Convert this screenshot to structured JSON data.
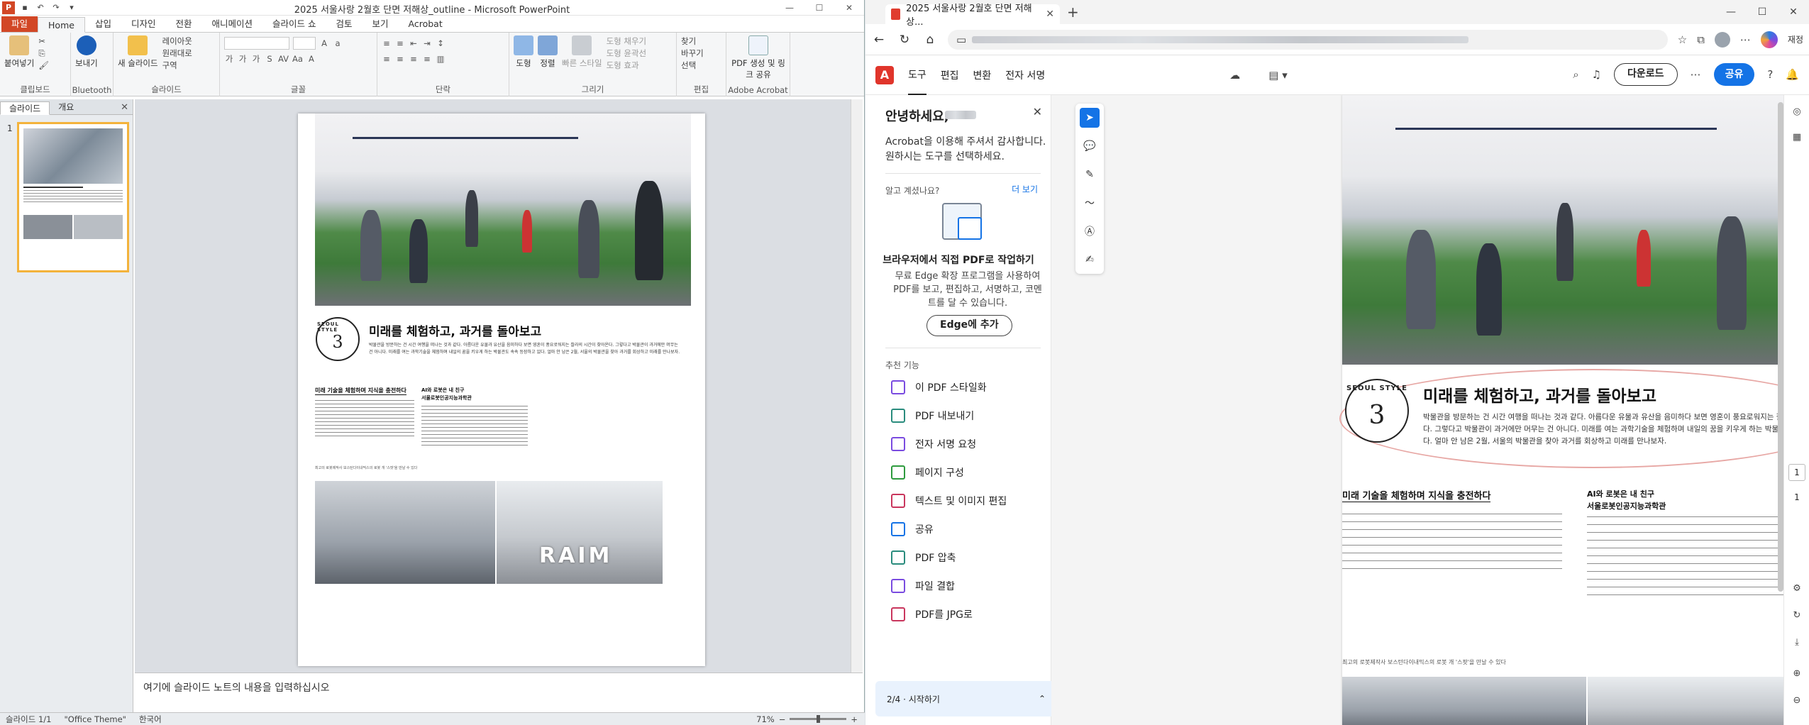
{
  "ppt": {
    "title": "2025 서울사랑 2월호 단면 저해상_outline - Microsoft PowerPoint",
    "tabs": [
      "파일",
      "Home",
      "삽입",
      "디자인",
      "전환",
      "애니메이션",
      "슬라이드 쇼",
      "검토",
      "보기",
      "Acrobat"
    ],
    "ribbon": {
      "clipboard": {
        "paste": "붙여넣기",
        "label": "클립보드"
      },
      "bluetooth": {
        "btn": "보내기",
        "label": "Bluetooth"
      },
      "slides": {
        "new": "새 슬라이드",
        "layout": "레이아웃",
        "reset": "원래대로",
        "section": "구역",
        "label": "슬라이드"
      },
      "font": {
        "label": "글꼴"
      },
      "paragraph": {
        "label": "단락"
      },
      "drawing": {
        "shapes": "도형",
        "arrange": "정렬",
        "quick": "빠른 스타일",
        "fill": "도형 채우기",
        "outline": "도형 윤곽선",
        "effect": "도형 효과",
        "label": "그리기"
      },
      "editing": {
        "find": "찾기",
        "replace": "바꾸기",
        "select": "선택",
        "label": "편집"
      },
      "acrobat": {
        "create": "PDF 생성 및 링크 공유",
        "label": "Adobe Acrobat"
      }
    },
    "left_tabs": [
      "슬라이드",
      "개요"
    ],
    "slide_number": "1",
    "notes_placeholder": "여기에 슬라이드 노트의 내용을 입력하십시오",
    "status": {
      "slide": "슬라이드 1/1",
      "theme": "\"Office Theme\"",
      "lang": "한국어",
      "zoom": "71%"
    }
  },
  "article": {
    "badge_text": "SEOUL STYLE",
    "badge_num": "3",
    "title": "미래를 체험하고, 과거를 돌아보고",
    "intro": "박물관을 방문하는 건 시간 여행을 떠나는 것과 같다. 아름다운 유물과 유산을 음미하다 보면 영혼이 풍요로워지는 찰라의 시간이 찾아온다. 그렇다고 박물관이 과거에만 머무는 건 아니다. 미래를 여는 과학기술을 체험하며 내일의 꿈을 키우게 하는 박물관도 속속 등장하고 있다. 얼마 안 남은 2월, 서울의 박물관을 찾아 과거를 회상하고 미래를 만나보자.",
    "sub1": "미래 기술을 체험하며 지식을 충전하다",
    "sub2a": "AI와 로봇은 내 친구",
    "sub2b": "서울로봇인공지능과학관",
    "caption": "최고의 로봇제작사 보스턴다이내믹스의 로봇 개 '스팟'을 만날 수 있다",
    "dome_word": "RAIM"
  },
  "edge": {
    "tab_title": "2025 서울사랑 2월호 단면 저해상...",
    "sync": "재정"
  },
  "acrobat": {
    "menu": [
      "도구",
      "편집",
      "변환",
      "전자 서명"
    ],
    "download": "다운로드",
    "share": "공유",
    "panel": {
      "hello": "안녕하세요,",
      "intro": "Acrobat을 이용해 주셔서 감사합니다. 원하시는 도구를 선택하세요.",
      "know": "알고 계셨나요?",
      "more": "더 보기",
      "card_title": "브라우저에서 직접 PDF로 작업하기",
      "card_desc": "무료 Edge 확장 프로그램을 사용하여 PDF를 보고, 편집하고, 서명하고, 코멘트를 달 수 있습니다.",
      "edge_btn": "Edge에 추가",
      "rec": "추천 기능",
      "features": [
        "이 PDF 스타일화",
        "PDF 내보내기",
        "전자 서명 요청",
        "페이지 구성",
        "텍스트 및 이미지 편집",
        "공유",
        "PDF 압축",
        "파일 결합",
        "PDF를 JPG로"
      ],
      "footer": "2/4 · 시작하기"
    },
    "page_current": "1",
    "page_total": "1"
  }
}
